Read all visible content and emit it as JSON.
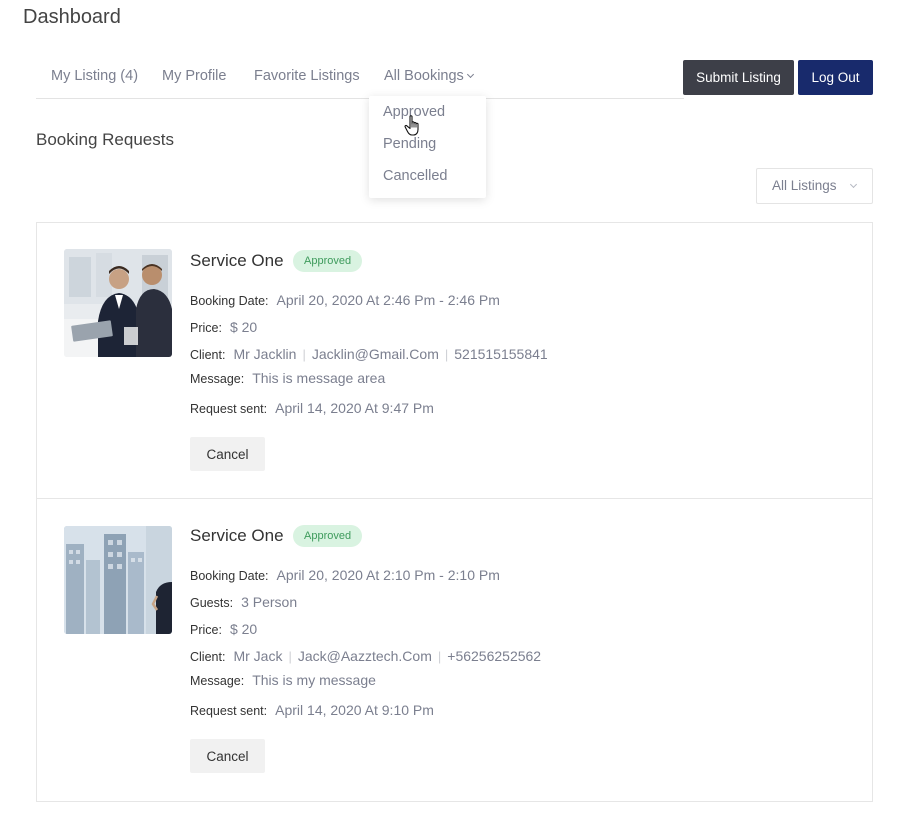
{
  "page": {
    "title": "Dashboard"
  },
  "nav": {
    "items": [
      {
        "label": "My Listing (4)"
      },
      {
        "label": "My Profile"
      },
      {
        "label": "Favorite Listings"
      },
      {
        "label": "All Bookings"
      }
    ],
    "submit_label": "Submit Listing",
    "logout_label": "Log Out",
    "dropdown": [
      "Approved",
      "Pending",
      "Cancelled"
    ]
  },
  "section": {
    "title": "Booking Requests"
  },
  "filter": {
    "selected": "All Listings"
  },
  "bookings": [
    {
      "title": "Service One",
      "status": "Approved",
      "booking_date_label": "Booking Date:",
      "booking_date": "April 20, 2020 At 2:46 Pm - 2:46 Pm",
      "price_label": "Price:",
      "price": "$ 20",
      "client_label": "Client:",
      "client_name": "Mr Jacklin",
      "client_email": "Jacklin@Gmail.Com",
      "client_phone": "521515155841",
      "message_label": "Message:",
      "message": "This is message area",
      "request_label": "Request sent:",
      "request_sent": "April 14, 2020 At 9:47 Pm",
      "cancel_label": "Cancel"
    },
    {
      "title": "Service One",
      "status": "Approved",
      "booking_date_label": "Booking Date:",
      "booking_date": "April 20, 2020 At 2:10 Pm - 2:10 Pm",
      "guests_label": "Guests:",
      "guests": "3 Person",
      "price_label": "Price:",
      "price": "$ 20",
      "client_label": "Client:",
      "client_name": "Mr Jack",
      "client_email": "Jack@Aazztech.Com",
      "client_phone": "+56256252562",
      "message_label": "Message:",
      "message": "This is my message",
      "request_label": "Request sent:",
      "request_sent": "April 14, 2020 At 9:10 Pm",
      "cancel_label": "Cancel"
    }
  ],
  "colors": {
    "submit_button": "#3d3f48",
    "logout_button": "#182a6c",
    "badge_bg": "#d9f3e1",
    "badge_text": "#3e9b5c",
    "muted_text": "#7b7f8f"
  }
}
